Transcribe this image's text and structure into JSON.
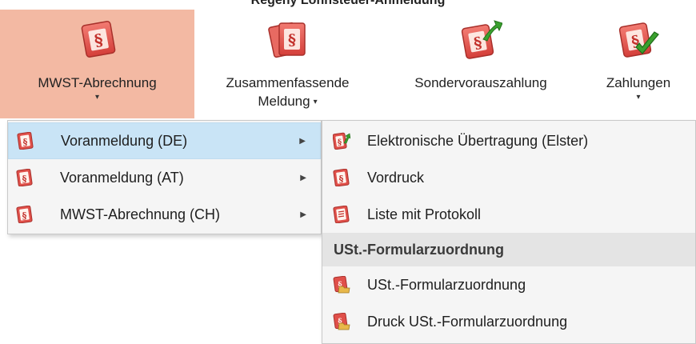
{
  "caption": "Regeny Lohnsteuer-Anmeldung",
  "ribbon": {
    "buttons": [
      {
        "label": "MWST-Abrechnung",
        "icon": "paragraph-doc-icon"
      },
      {
        "label_line1": "Zusammenfassende",
        "label_line2": "Meldung",
        "icon": "paragraph-docs-stack-icon"
      },
      {
        "label": "Sondervorauszahlung",
        "icon": "paragraph-doc-green-arrow-icon"
      },
      {
        "label": "Zahlungen",
        "icon": "paragraph-doc-checkmark-icon"
      }
    ],
    "caret": "▾"
  },
  "left_menu": {
    "items": [
      {
        "label": "Voranmeldung (DE)",
        "highlighted": true
      },
      {
        "label": "Voranmeldung (AT)"
      },
      {
        "label": "MWST-Abrechnung (CH)"
      }
    ],
    "submenu_arrow": "▶"
  },
  "right_menu": {
    "items": [
      {
        "label": "Elektronische Übertragung (Elster)"
      },
      {
        "label": "Vordruck"
      },
      {
        "label": "Liste mit Protokoll"
      }
    ],
    "section_header": "USt.-Formularzuordnung",
    "section_items": [
      {
        "label": "USt.-Formularzuordnung"
      },
      {
        "label": "Druck USt.-Formularzuordnung"
      }
    ]
  },
  "colors": {
    "ribbon_active_bg": "#f3b9a3",
    "menu_highlight": "#c9e4f6",
    "menu_bg": "#f5f5f5",
    "section_header_bg": "#e4e4e4",
    "icon_red": "#e0504a",
    "icon_green": "#3aa12e"
  }
}
